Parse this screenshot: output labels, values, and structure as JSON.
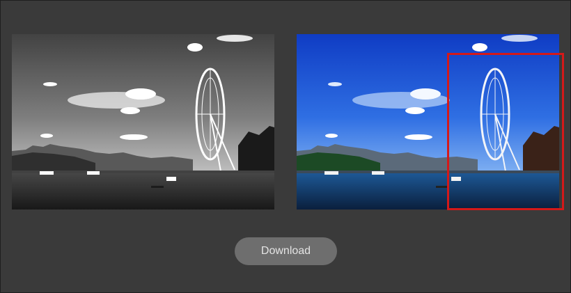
{
  "actions": {
    "download_label": "Download"
  },
  "images": {
    "left": {
      "name": "grayscale-preview",
      "filter": "grayscale"
    },
    "right": {
      "name": "color-preview",
      "filter": "color"
    }
  },
  "colors": {
    "page_background": "#3a3a3a",
    "button_background": "#6e6e6e",
    "button_text": "#e4e4e4",
    "selection_border": "#d41919"
  }
}
